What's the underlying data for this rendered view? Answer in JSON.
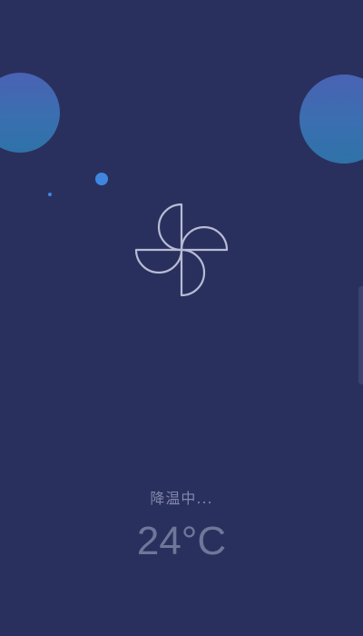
{
  "status": {
    "text": "降温中..."
  },
  "temperature": {
    "value": "24°C"
  },
  "icons": {
    "fan": "pinwheel-fan-icon"
  },
  "colors": {
    "background": "#2a305d",
    "bubble_top": "#4a62b4",
    "bubble_bottom": "#2e72a8",
    "dot": "#3f86e0",
    "fan_stroke": "#b7bbd6",
    "text": "#8287ab"
  }
}
